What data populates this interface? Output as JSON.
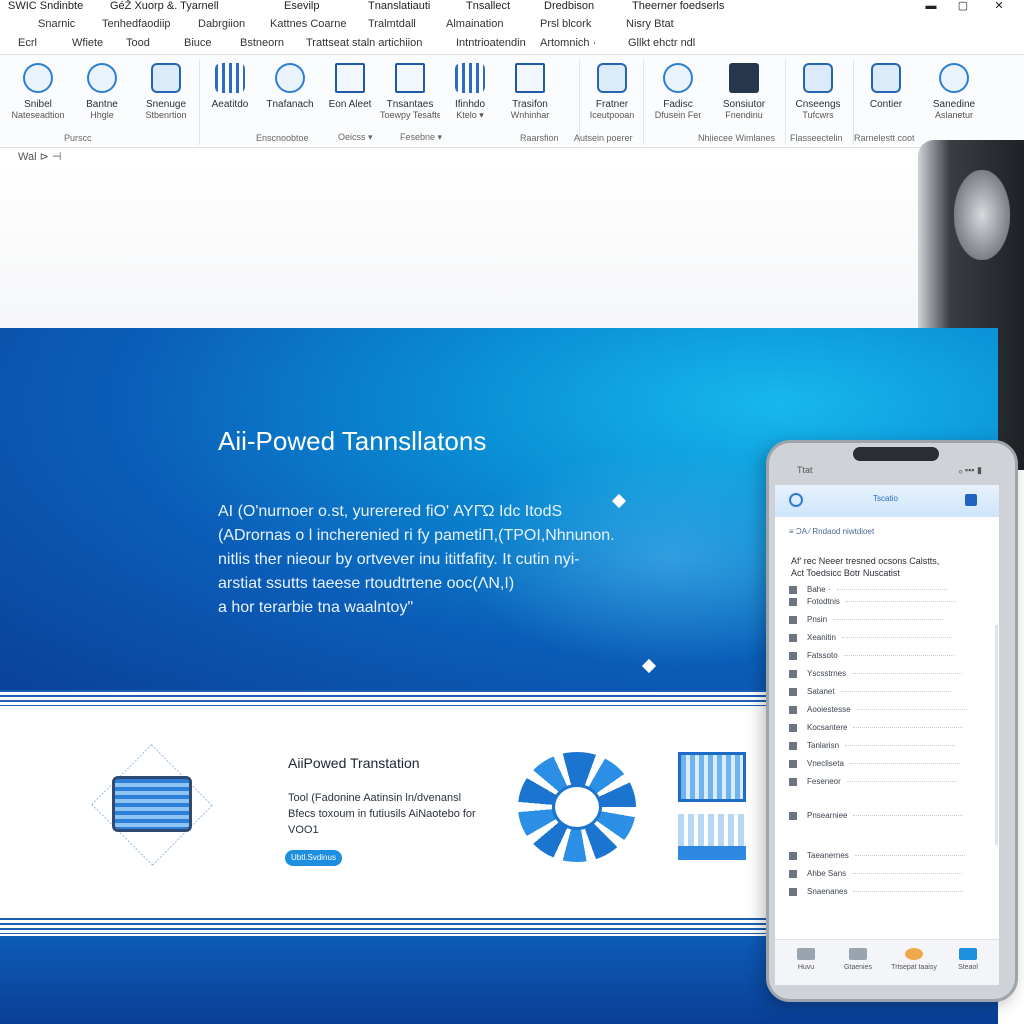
{
  "ribbon": {
    "tabs_row1": [
      "SWIC Sndinbte",
      "GéŽ Xuorp &. Tyarnell",
      "Esevilp",
      "Tnanslatiauti",
      "Tnsallect",
      "Dredbison",
      "Theerner foedserls"
    ],
    "tabs_row2": [
      "Snarnic",
      "Tenhedfaodiip",
      "Dabrgiion",
      "Kattnes Coarne",
      "Tralmtdall",
      "Almaination",
      "Prsl blcork",
      "Nisry Btat"
    ],
    "tabs_row3": [
      "Ecrl",
      "Wfiete",
      "Tood",
      "Biuce",
      "Bstneorn",
      "Trattseat staln artichiion",
      "Intntrioatendin",
      "Artomnich ·",
      "Gllkt ehctr ndl"
    ],
    "window_controls": [
      "▬",
      "▢",
      "✕"
    ],
    "buttons": [
      {
        "label": "Snibel",
        "sub": "Nateseadtion",
        "icon": "globe-icon"
      },
      {
        "label": "Bantne",
        "sub": "Hhgle",
        "icon": "globe-icon"
      },
      {
        "label": "Snenuge",
        "sub": "Stbenrtion",
        "icon": "monitor-icon"
      },
      {
        "label": "Aeatitdo",
        "sub": "",
        "icon": "bars-icon"
      },
      {
        "label": "Tnafanach",
        "sub": "",
        "icon": "globe-icon"
      },
      {
        "label": "Eon Aleet",
        "sub": "",
        "icon": "robot-icon"
      },
      {
        "label": "Tnsantaes",
        "sub": "Toewpy Tesaftes",
        "icon": "document-icon"
      },
      {
        "label": "Ifinhdo",
        "sub": "Ktelo ▾",
        "icon": "bars-icon"
      },
      {
        "label": "Trasifon",
        "sub": "Wnhinhar",
        "icon": "document-icon"
      },
      {
        "label": "Fratner",
        "sub": "Iceutpooan",
        "icon": "monitor-icon"
      },
      {
        "label": "Fadisc",
        "sub": "Dfusein Fer",
        "icon": "globe-icon"
      },
      {
        "label": "Sonsiutor",
        "sub": "Fnendinu",
        "icon": "robot-icon"
      },
      {
        "label": "Cnseengs",
        "sub": "Tufcwrs",
        "icon": "monitor-icon"
      },
      {
        "label": "Contier",
        "sub": "",
        "icon": "monitor-icon"
      },
      {
        "label": "Sanedine",
        "sub": "Aslanetur",
        "icon": "globe-icon"
      }
    ],
    "group_labels": [
      "Purscc",
      "Enscnoobtoe",
      "Oeicss ▾",
      "Fesebne ▾",
      "Raarsfion",
      "Autsein poerer",
      "Nhiiecee Wimlanes",
      "Flasseectelin",
      "Rarnelestt coot"
    ],
    "quick_access": "Wal ⊳ ⊣"
  },
  "hero": {
    "title": "Aii-Powed Tannsllatons",
    "text": [
      "AI (Ο'nurnoer o.st, yurerered fiΟ' AYΓΏ Idc ItodS",
      "(ADrornas o l incherenied ri fy pametiΠ,(ΤΡΟΙ,Νhnunon.",
      "nitlis ther nieour by ortvever inu ititfafity. It cutin nyi-",
      "arstiat ssutts taeese rtoudtrtene ooc(ΛΝ,Ι)",
      "a hor terarbie tna waalntoy\""
    ]
  },
  "feature": {
    "title": "AiiPowed Transtation",
    "text": [
      "Tool (Fadonine Aatinsin ln/dvenansl",
      "Bfecs toxoum in futiusils AiNaotebo for",
      "VOO1"
    ],
    "button_label": "Ubtl.Svdinus"
  },
  "phone": {
    "status_left": "Ttat",
    "status_right": "ₒ ▪▪▪ ▮",
    "header_title": "Tscatio",
    "toolbar": "≡   ϽΑ   ⁄ Rndaod niwtdioet",
    "heading": [
      "Af' rec Neeer tresned ocsons Calstts,",
      "Act Toedsicc Botr Nuscatist"
    ],
    "rows": [
      {
        "icon": "bullet-icon",
        "text": "Bahe ·"
      },
      {
        "icon": "bullet-icon",
        "text": "Fotodtnis"
      },
      {
        "icon": "row-icon",
        "text": "Pnsin"
      },
      {
        "icon": "row-icon",
        "text": "Xeanitin"
      },
      {
        "icon": "row-icon",
        "text": "Fatssoto"
      },
      {
        "icon": "row-icon",
        "text": "Yscsstrnes"
      },
      {
        "icon": "row-icon",
        "text": "Satanet"
      },
      {
        "icon": "row-icon",
        "text": "Aooiestesse"
      },
      {
        "icon": "row-icon",
        "text": "Kocsantere"
      },
      {
        "icon": "row-icon",
        "text": "Tanlarisn"
      },
      {
        "icon": "row-icon",
        "text": "Vnecliseta"
      },
      {
        "icon": "row-icon",
        "text": "Feseneor"
      },
      {
        "icon": "row-icon",
        "text": "Pnsearniee"
      },
      {
        "icon": "row-icon",
        "text": "Taeanernes"
      },
      {
        "icon": "row-icon",
        "text": "Ahbe Sans"
      },
      {
        "icon": "row-icon",
        "text": "Snaenanes"
      }
    ],
    "tabs": [
      {
        "label": "Huvu",
        "icon": "list-icon"
      },
      {
        "label": "Gtaenies",
        "icon": "document-icon"
      },
      {
        "label": "Trtsepat taaisy",
        "icon": "heart-icon"
      },
      {
        "label": "Steaol",
        "icon": "chevron-down-icon"
      }
    ]
  },
  "colors": {
    "accent": "#1e8fe0",
    "hero_dark": "#0a3f97",
    "hero_light": "#17b8ee"
  }
}
